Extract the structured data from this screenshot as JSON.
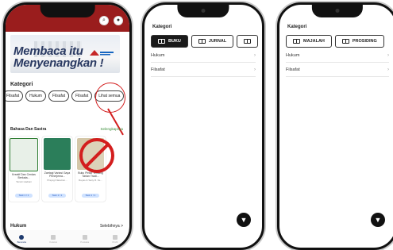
{
  "phone1": {
    "banner": {
      "line1": "Membaca itu",
      "line2": "Menyenangkan !"
    },
    "kategori_title": "Kategori",
    "chips": [
      "Filsafat",
      "Hukum",
      "Filsafat",
      "Filsafat",
      "Lihat semua"
    ],
    "bahasa_title": "Bahasa Dan Sastra",
    "selengkapnya": "Selengkapnya",
    "books": [
      {
        "title": "Kreatif Dan Cerdas Berkata...",
        "sub": "Tarsini Hadiani",
        "pill": "Stok 1 / 1",
        "cover": "#e8f0e8"
      },
      {
        "title": "Zaetagi Variasi Gaya Penerjema...",
        "sub": "Prayogi Nasution...",
        "pill": "Stok 1 / 1",
        "cover": "#2b7e5a"
      },
      {
        "title": "Buku Pintar Tentang Tarian Tradi...",
        "sub": "Reyas & Sany R. Fe...",
        "pill": "Stok 1 / 1",
        "cover": "#d4c7a8"
      }
    ],
    "hukum_title": "Hukum",
    "selengkapnya2": "Selebihnya >",
    "nav": [
      "Beranda",
      "Koleksi",
      "Pustaka",
      "Profil"
    ]
  },
  "phone2": {
    "kategori_title": "Kategori",
    "tabs": [
      "BUKU",
      "JURNAL"
    ],
    "rows": [
      "Hukum",
      "Filsafat"
    ],
    "fab_icon": "▼"
  },
  "phone3": {
    "kategori_title": "Kategori",
    "tabs": [
      "MAJALAH",
      "PROSIDING"
    ],
    "rows": [
      "Hukum",
      "Filsafat"
    ],
    "fab_icon": "▼"
  }
}
